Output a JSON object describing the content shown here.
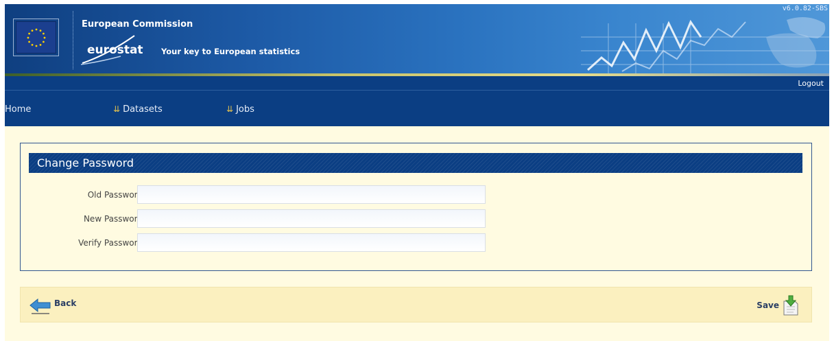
{
  "header": {
    "organization": "European Commission",
    "brand": "eurostat",
    "tagline": "Your key to European statistics",
    "version": "v6.0.82-SBS",
    "flag_icon": "eu-flag-icon"
  },
  "nav": {
    "logout": "Logout",
    "items": [
      {
        "label": "Home"
      },
      {
        "label": "Datasets",
        "icon": "double-chevron-down-icon"
      },
      {
        "label": "Jobs",
        "icon": "double-chevron-down-icon"
      }
    ]
  },
  "form": {
    "title": "Change Password",
    "fields": [
      {
        "label": "Old Password",
        "value": ""
      },
      {
        "label": "New Password",
        "value": ""
      },
      {
        "label": "Verify Password",
        "value": ""
      }
    ]
  },
  "actions": {
    "back": "Back",
    "save": "Save"
  },
  "colors": {
    "navy": "#0b3e83",
    "page_bg": "#fffbe1",
    "action_bar_bg": "#fbf0bf"
  }
}
